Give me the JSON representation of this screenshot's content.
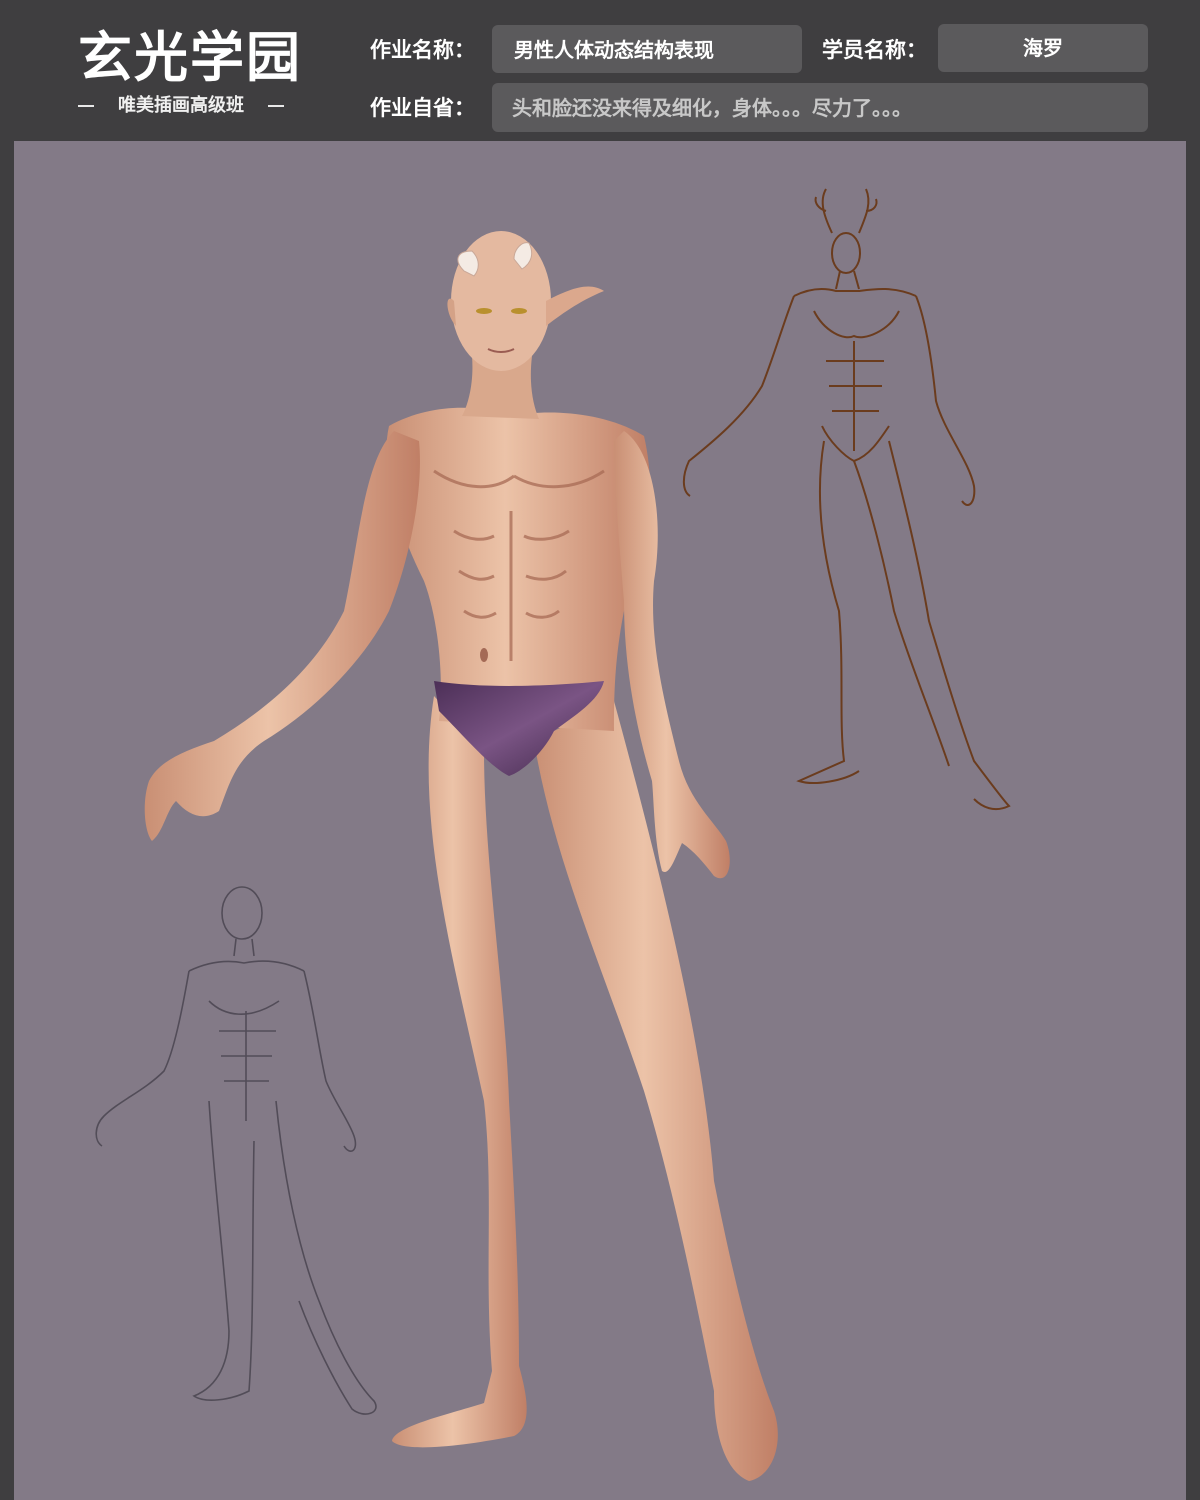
{
  "logo": {
    "title": "玄光学园",
    "subtitle": "唯美插画高级班"
  },
  "form": {
    "assignment_name_label": "作业名称：",
    "assignment_name_value": "男性人体动态结构表现",
    "student_name_label": "学员名称：",
    "student_name_value": "海罗",
    "self_review_label": "作业自省：",
    "self_review_value": "头和脸还没来得及细化，身体。。。尽力了。。。"
  },
  "colors": {
    "header_bg": "#3f3e40",
    "field_bg": "#5b5a5c",
    "canvas_bg": "#837a87",
    "skin": "#e2b49a",
    "briefs": "#5a3a62",
    "sketch_brown": "#6b3c1e",
    "sketch_gray": "#4a4550"
  }
}
